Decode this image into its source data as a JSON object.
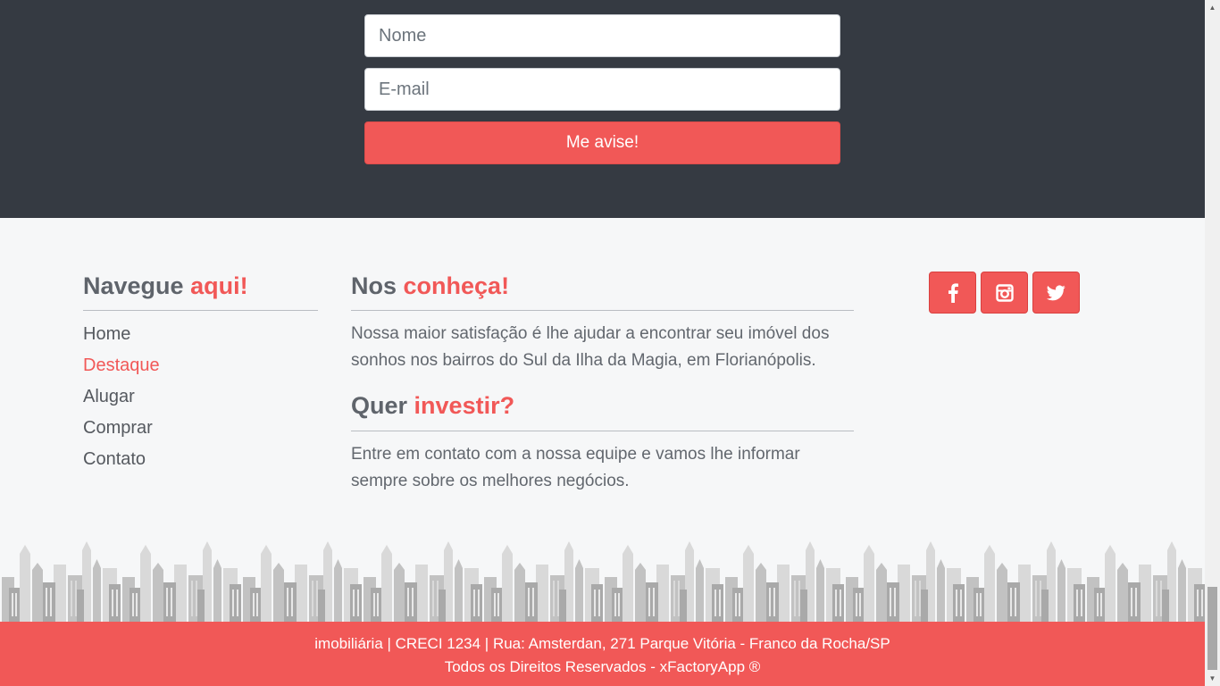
{
  "newsletter": {
    "name_placeholder": "Nome",
    "email_placeholder": "E-mail",
    "submit_label": "Me avise!"
  },
  "navigate": {
    "heading_plain": "Navegue",
    "heading_accent": "aqui!",
    "items": [
      {
        "label": "Home"
      },
      {
        "label": "Destaque"
      },
      {
        "label": "Alugar"
      },
      {
        "label": "Comprar"
      },
      {
        "label": "Contato"
      }
    ],
    "active_item": "Destaque"
  },
  "about": {
    "heading_plain": "Nos",
    "heading_accent": "conheça!",
    "text": "Nossa maior satisfação é lhe ajudar a encontrar seu imóvel dos sonhos nos bairros do Sul da Ilha da Magia, em Florianópolis."
  },
  "invest": {
    "heading_plain": "Quer",
    "heading_accent": "investir?",
    "text": "Entre em contato com a nossa equipe e vamos lhe informar sempre sobre os melhores negócios."
  },
  "social": {
    "icons": [
      "facebook-icon",
      "instagram-icon",
      "twitter-icon"
    ]
  },
  "footer": {
    "line1": "imobiliária | CRECI 1234 | Rua: Amsterdan, 271 Parque Vitória - Franco da Rocha/SP",
    "line2": "Todos os Direitos Reservados - xFactoryApp ®"
  },
  "colors": {
    "accent": "#f15857",
    "dark_band": "#353a42",
    "background": "#f6f7f8"
  }
}
